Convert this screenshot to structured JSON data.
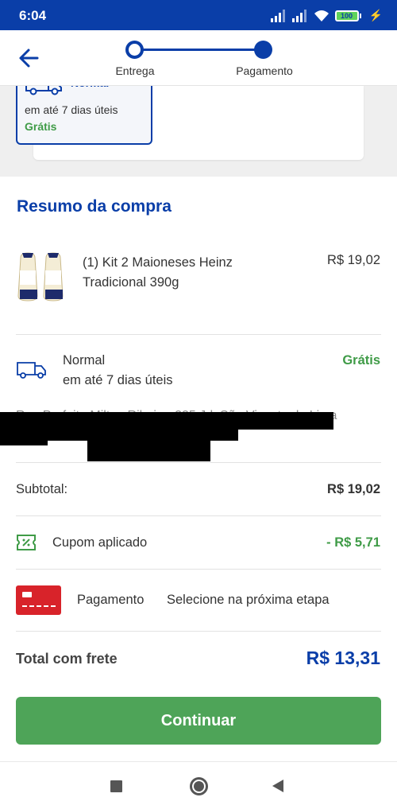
{
  "status_bar": {
    "time": "6:04",
    "battery": "100"
  },
  "header": {
    "steps": [
      {
        "label": "Entrega"
      },
      {
        "label": "Pagamento"
      }
    ]
  },
  "shipping_option": {
    "title": "Normal",
    "delivery_time": "em até 7 dias úteis",
    "price": "Grátis"
  },
  "summary": {
    "title": "Resumo da compra",
    "product": {
      "name": "(1) Kit 2 Maioneses Heinz Tradicional 390g",
      "price": "R$ 19,02"
    },
    "delivery": {
      "name": "Normal",
      "time": "em até 7 dias úteis",
      "price": "Grátis"
    },
    "address": "Rua Prefeito Milton Ribeiro, 225 Jd. São Vicente de Lima",
    "subtotal": {
      "label": "Subtotal:",
      "value": "R$ 19,02"
    },
    "coupon": {
      "label": "Cupom aplicado",
      "value": "- R$ 5,71"
    },
    "payment": {
      "label": "Pagamento",
      "value": "Selecione na próxima etapa"
    },
    "total": {
      "label": "Total com frete",
      "value": "R$ 13,31"
    }
  },
  "actions": {
    "continue_label": "Continuar"
  },
  "colors": {
    "brand_blue": "#0a3ea8",
    "success_green": "#3f9b47",
    "button_green": "#4ea458",
    "payment_red": "#d8232a"
  }
}
